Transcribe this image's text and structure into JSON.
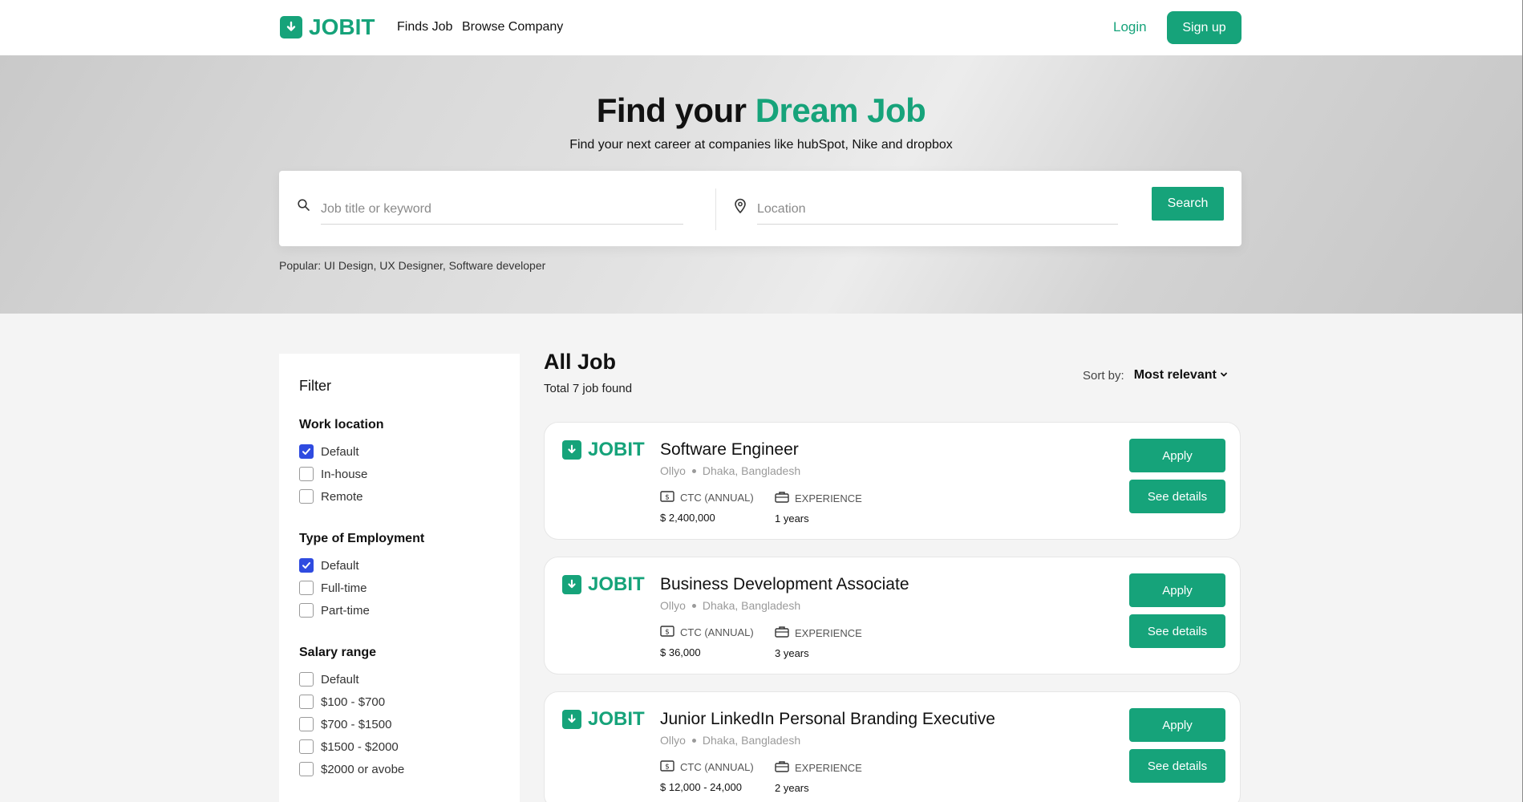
{
  "brand": {
    "name": "JOBIT",
    "accent": "#16a37a"
  },
  "nav": {
    "items": [
      "Finds Job",
      "Browse Company"
    ],
    "login": "Login",
    "signup": "Sign up"
  },
  "hero": {
    "title_prefix": "Find your",
    "title_accent": "Dream Job",
    "subtitle": "Find your next career at companies like hubSpot, Nike and dropbox",
    "keyword_placeholder": "Job title or keyword",
    "location_placeholder": "Location",
    "search_label": "Search",
    "popular": "Popular: UI Design, UX Designer, Software developer"
  },
  "filter": {
    "title": "Filter",
    "groups": [
      {
        "title": "Work location",
        "options": [
          {
            "label": "Default",
            "checked": true
          },
          {
            "label": "In-house",
            "checked": false
          },
          {
            "label": "Remote",
            "checked": false
          }
        ]
      },
      {
        "title": "Type of Employment",
        "options": [
          {
            "label": "Default",
            "checked": true
          },
          {
            "label": "Full-time",
            "checked": false
          },
          {
            "label": "Part-time",
            "checked": false
          }
        ]
      },
      {
        "title": "Salary range",
        "options": [
          {
            "label": "Default",
            "checked": false
          },
          {
            "label": "$100 - $700",
            "checked": false
          },
          {
            "label": "$700 - $1500",
            "checked": false
          },
          {
            "label": "$1500 - $2000",
            "checked": false
          },
          {
            "label": "$2000 or avobe",
            "checked": false
          }
        ]
      }
    ]
  },
  "jobs_section": {
    "title": "All Job",
    "total": "Total 7 job found",
    "sort_label": "Sort by:",
    "sort_value": "Most relevant",
    "ctc_label": "CTC (ANNUAL)",
    "exp_label": "EXPERIENCE",
    "apply_label": "Apply",
    "details_label": "See details",
    "jobs": [
      {
        "title": "Software Engineer",
        "company": "Ollyo",
        "location": "Dhaka, Bangladesh",
        "ctc": "$ 2,400,000",
        "experience": "1 years"
      },
      {
        "title": "Business Development Associate",
        "company": "Ollyo",
        "location": "Dhaka, Bangladesh",
        "ctc": "$ 36,000",
        "experience": "3 years"
      },
      {
        "title": "Junior LinkedIn Personal Branding Executive",
        "company": "Ollyo",
        "location": "Dhaka, Bangladesh",
        "ctc": "$ 12,000 - 24,000",
        "experience": "2 years"
      }
    ]
  }
}
